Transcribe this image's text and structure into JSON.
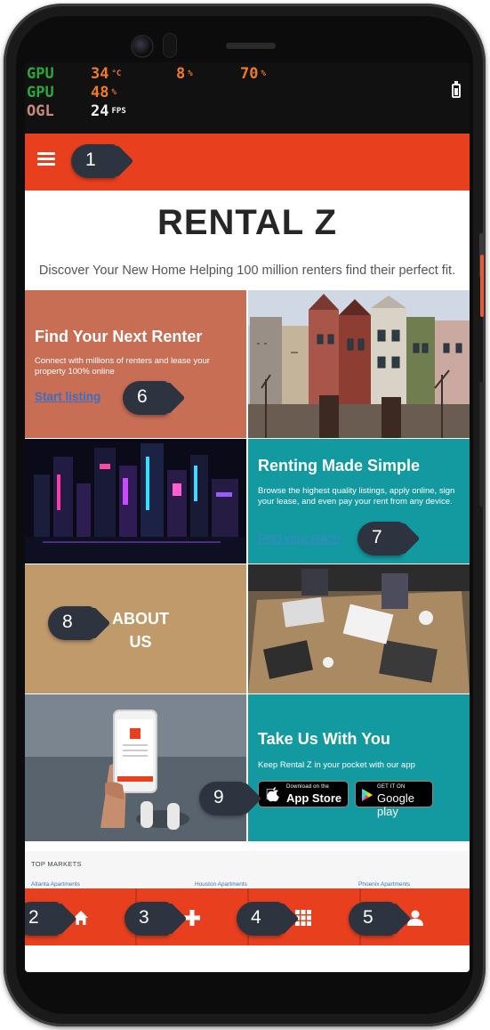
{
  "overlay": {
    "gpu1_label": "GPU",
    "gpu1_temp": "34",
    "gpu1_temp_unit": "°C",
    "gpu1_load": "8",
    "gpu1_load_unit": "%",
    "gpu1_mem": "70",
    "gpu1_mem_unit": "%",
    "gpu2_label": "GPU",
    "gpu2_value": "48",
    "gpu2_unit": "%",
    "ogl_label": "OGL",
    "fps_value": "24",
    "fps_unit": "FPS"
  },
  "app": {
    "title": "RENTAL Z",
    "tagline": "Discover Your New Home Helping 100 million renters find their perfect fit."
  },
  "tiles": {
    "renter": {
      "heading": "Find Your Next Renter",
      "body": "Connect with millions of renters and lease your property 100% online",
      "link": "Start listing"
    },
    "simple": {
      "heading": "Renting Made Simple",
      "body": "Browse the highest quality listings, apply online, sign your lease, and even pay your rent from any device.",
      "link": "Find your place"
    },
    "about": {
      "line1": "ABOUT",
      "line2": "US"
    },
    "take": {
      "heading": "Take Us With You",
      "body": "Keep Rental Z in your pocket with our app",
      "appstore_small": "Download on the",
      "appstore_big": "App Store",
      "googleplay_small": "GET IT ON",
      "googleplay_big": "Google play"
    }
  },
  "markets": {
    "heading": "TOP MARKETS",
    "items": [
      "Atlanta Apartments",
      "Houston Apartments",
      "Phoenix Apartments"
    ]
  },
  "bottom_nav": {
    "icons": [
      "home-icon",
      "plus-icon",
      "grid-icon",
      "user-icon"
    ]
  },
  "callouts": [
    "1",
    "2",
    "3",
    "4",
    "5",
    "6",
    "7",
    "8",
    "9"
  ],
  "colors": {
    "brand": "#e8401f",
    "teal": "#129aa0",
    "terracotta": "#c76e55",
    "tan": "#c19a6b",
    "callout": "#2d3440"
  }
}
